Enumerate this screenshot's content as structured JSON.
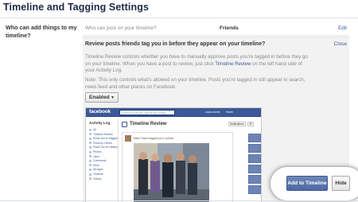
{
  "page": {
    "title": "Timeline and Tagging Settings"
  },
  "section": {
    "label": "Who can add things to my timeline?"
  },
  "row": {
    "question": "Who can post on your timeline?",
    "value": "Friends",
    "edit_label": "Edit"
  },
  "panel": {
    "heading": "Review posts friends tag you in before they appear on your timeline?",
    "close_label": "Close",
    "desc_before": "Timeline Review controls whether you have to manually approve posts you're tagged in before they go on your timeline. When you have a post to review, just click ",
    "desc_link": "Timeline Review",
    "desc_after": " on the left hand side of your Activity Log.",
    "note": "Note: This only controls what's allowed on your timeline. Posts you're tagged in still appear in search, news feed and other places on Facebook",
    "select": {
      "value": "Enabled",
      "arrow_icon": "caret-down-icon"
    }
  },
  "preview": {
    "logo": "facebook",
    "search_placeholder": "Search for people, places and things",
    "user_label": "Laura Jones",
    "home_label": "Home",
    "nav_title": "Activity Log",
    "nav_items": [
      "All",
      "Timeline Review",
      "Posts You're Tagged In",
      "Posts by Others",
      "Posts You've Hidden",
      "Photos",
      "Likes",
      "Comments",
      "More",
      "All Apps",
      "Timeline",
      "Videos"
    ],
    "content_title": "Timeline Review",
    "notifications_label": "Notifications",
    "story_line": "Maria Franco tagged you in a photo.",
    "add_to_timeline": "Add to Timeline",
    "hide": "Hide"
  },
  "colors": {
    "brand": "#3b5998",
    "link": "#3b5998",
    "panel_bg": "#f2f2f2"
  }
}
